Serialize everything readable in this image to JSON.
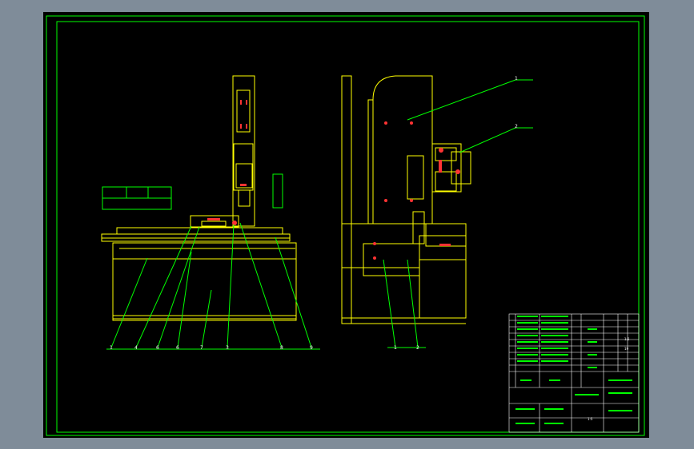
{
  "colors": {
    "background": "#7f8c99",
    "sheet": "#000000",
    "frame": "#00ff00",
    "machine": "#ffff00",
    "accent": "#ff3333",
    "text": "#ffffff"
  },
  "front_view": {
    "callouts": [
      "1",
      "4",
      "6",
      "6",
      "7",
      "3",
      "8",
      "9"
    ]
  },
  "side_view": {
    "callouts": [
      "1",
      "2"
    ],
    "bottom_labels": [
      "1",
      "2"
    ]
  },
  "title_block": {
    "scale": "1:5",
    "sheet_label": "1:2",
    "sheet_no": "19"
  }
}
